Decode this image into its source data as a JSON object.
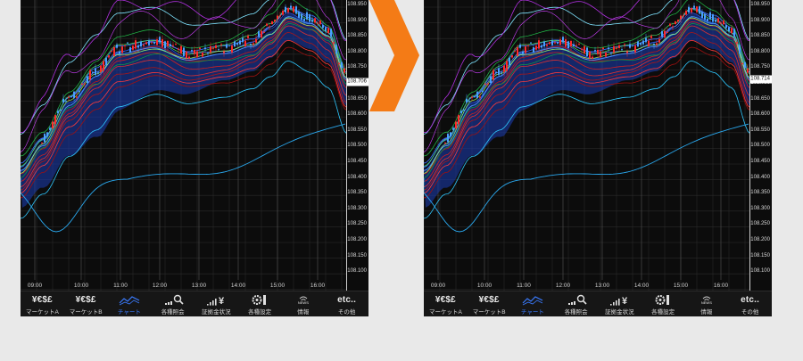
{
  "screens": [
    {
      "price_tag": "108.706",
      "yaxis_ticks": [
        "108.950",
        "108.900",
        "108.850",
        "108.800",
        "108.750",
        "108.700",
        "108.650",
        "108.600",
        "108.550",
        "108.500",
        "108.450",
        "108.400",
        "108.350",
        "108.300",
        "108.250",
        "108.200",
        "108.150",
        "108.100"
      ],
      "time_ticks": [
        "09:00",
        "10:00",
        "11:00",
        "12:00",
        "13:00",
        "14:00",
        "15:00",
        "16:00"
      ]
    },
    {
      "price_tag": "108.714",
      "yaxis_ticks": [
        "108.950",
        "108.900",
        "108.850",
        "108.800",
        "108.750",
        "108.700",
        "108.650",
        "108.600",
        "108.550",
        "108.500",
        "108.450",
        "108.400",
        "108.350",
        "108.300",
        "108.250",
        "108.200",
        "108.150",
        "108.100"
      ],
      "time_ticks": [
        "09:00",
        "10:00",
        "11:00",
        "12:00",
        "13:00",
        "14:00",
        "15:00",
        "16:00"
      ]
    }
  ],
  "nav": [
    {
      "icon": "¥€$£",
      "label": "マーケットA",
      "icon_name": "currency-icon"
    },
    {
      "icon": "¥€$£",
      "label": "マーケットB",
      "icon_name": "currency-icon"
    },
    {
      "icon": "",
      "label": "チャート",
      "icon_name": "chart-icon",
      "active": true
    },
    {
      "icon": "",
      "label": "各種照会",
      "icon_name": "search-icon"
    },
    {
      "icon": "",
      "label": "証拠金状況",
      "icon_name": "margin-yen-icon"
    },
    {
      "icon": "",
      "label": "各種設定",
      "icon_name": "settings-icon"
    },
    {
      "icon": "NEWS",
      "label": "情報",
      "icon_name": "news-icon"
    },
    {
      "icon": "etc..",
      "label": "その他",
      "icon_name": "etc-icon"
    }
  ],
  "colors": {
    "accent": "#3a7bff",
    "arrow": "#f47b16",
    "background": "#e9e9e9"
  }
}
